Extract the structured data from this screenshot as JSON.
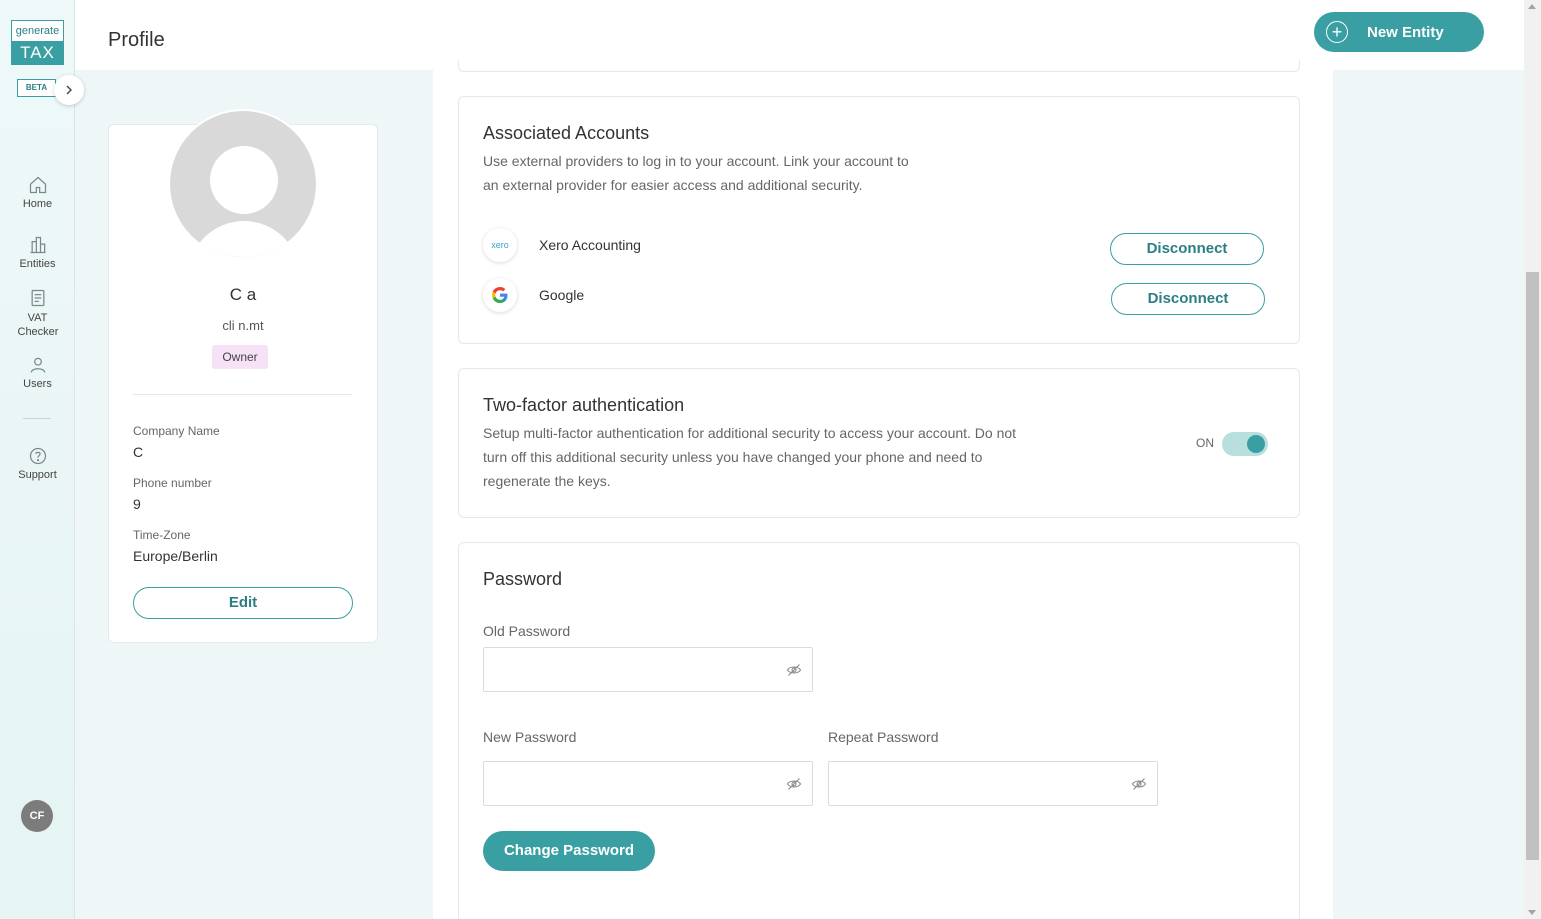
{
  "sidebar": {
    "logo_top": "generate",
    "logo_bottom": "TAX",
    "beta": "BETA",
    "items": [
      {
        "label": "Home",
        "icon": "home-icon"
      },
      {
        "label": "Entities",
        "icon": "buildings-icon"
      },
      {
        "label": "VAT Checker",
        "icon": "document-icon"
      },
      {
        "label": "Users",
        "icon": "user-icon"
      },
      {
        "label": "Support",
        "icon": "help-icon"
      }
    ],
    "user_initials": "CF"
  },
  "header": {
    "title": "Profile",
    "new_entity_label": "New Entity"
  },
  "profile": {
    "name": "C          a",
    "email": "cli              n.mt",
    "role": "Owner",
    "company_label": "Company Name",
    "company_value": "C",
    "phone_label": "Phone number",
    "phone_value": "9",
    "timezone_label": "Time-Zone",
    "timezone_value": "Europe/Berlin",
    "edit_label": "Edit"
  },
  "associated_accounts": {
    "title": "Associated Accounts",
    "description_line1": "Use external providers to log in to your account. Link your account to",
    "description_line2": "an external provider for easier access and additional security.",
    "accounts": [
      {
        "name": "Xero Accounting",
        "icon": "xero-icon",
        "icon_text": "xero",
        "action": "Disconnect"
      },
      {
        "name": "Google",
        "icon": "google-icon",
        "icon_text": "G",
        "action": "Disconnect"
      }
    ]
  },
  "two_factor": {
    "title": "Two-factor authentication",
    "description_line1": "Setup multi-factor authentication for additional security to access your account. Do not",
    "description_line2": "turn off this additional security unless you have changed your phone and need to",
    "description_line3": "regenerate the keys.",
    "status_label": "ON",
    "enabled": true
  },
  "password": {
    "title": "Password",
    "old_label": "Old Password",
    "new_label": "New Password",
    "repeat_label": "Repeat Password",
    "old_value": "",
    "new_value": "",
    "repeat_value": "",
    "submit_label": "Change Password"
  },
  "colors": {
    "accent": "#3a9fa3",
    "accent_dark": "#2b7f83",
    "owner_badge": "#f7e1f7",
    "sidebar_bg": "#eef8f8"
  }
}
